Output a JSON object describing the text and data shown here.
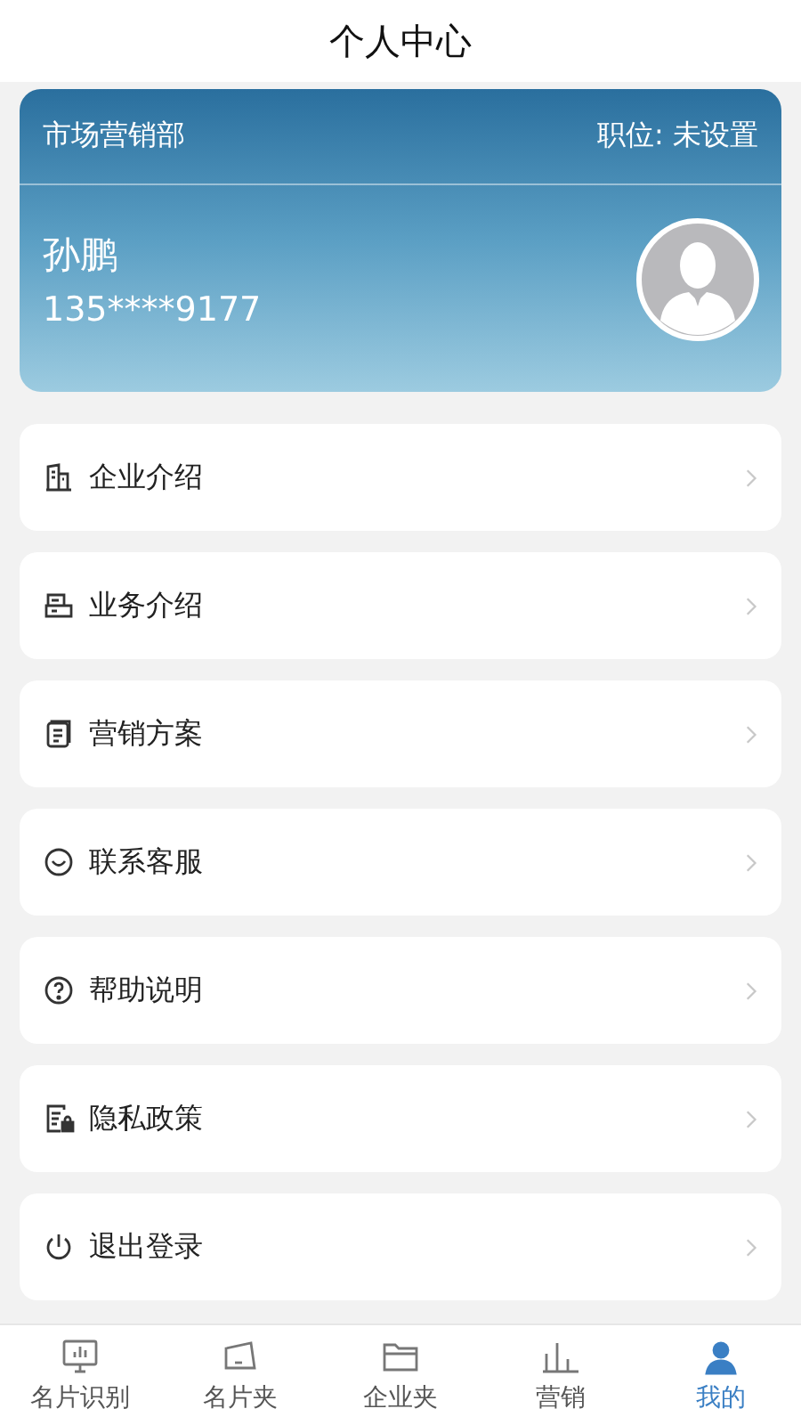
{
  "header": {
    "title": "个人中心"
  },
  "profile": {
    "department": "市场营销部",
    "position": "职位: 未设置",
    "name": "孙鹏",
    "phone": "135****9177"
  },
  "menu": [
    {
      "label": "企业介绍"
    },
    {
      "label": "业务介绍"
    },
    {
      "label": "营销方案"
    },
    {
      "label": "联系客服"
    },
    {
      "label": "帮助说明"
    },
    {
      "label": "隐私政策"
    },
    {
      "label": "退出登录"
    }
  ],
  "tabs": [
    {
      "label": "名片识别",
      "selected": false
    },
    {
      "label": "名片夹",
      "selected": false
    },
    {
      "label": "企业夹",
      "selected": false
    },
    {
      "label": "营销",
      "selected": false
    },
    {
      "label": "我的",
      "selected": true
    }
  ]
}
